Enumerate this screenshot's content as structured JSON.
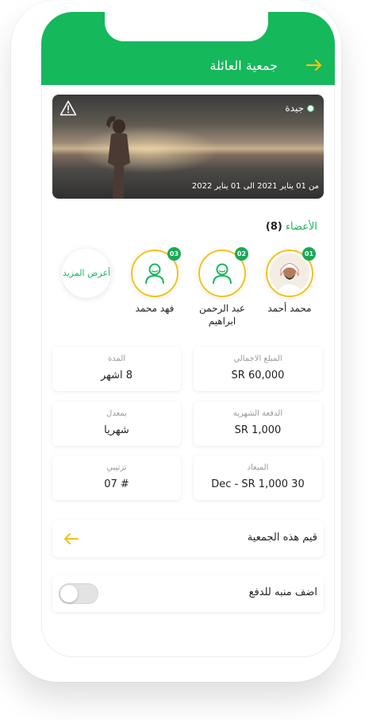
{
  "header": {
    "title": "جمعية العائلة",
    "back_icon": "arrow-right-icon",
    "accent": "#15b85b"
  },
  "banner": {
    "status_label": "جيدة",
    "status_color": "#2bd16e",
    "date_range": "من 01 يناير 2021 الى 01 يناير 2022",
    "warning_icon": "warning-icon"
  },
  "members": {
    "title": "الأعضاء",
    "count": "(8)",
    "items": [
      {
        "number": "01",
        "name": "محمد أحمد",
        "avatar": "photo"
      },
      {
        "number": "02",
        "name": "عبد الرحمن ابراهيم",
        "avatar": "person-icon"
      },
      {
        "number": "03",
        "name": "فهد محمد",
        "avatar": "person-icon"
      }
    ],
    "more_label": "أعرض المزيد"
  },
  "stats": [
    {
      "label": "المبلغ الاجمالي",
      "value": "SR 60,000"
    },
    {
      "label": "المدة",
      "value": "8 اشهر"
    },
    {
      "label": "الدفعة الشهرية",
      "value": "SR 1,000"
    },
    {
      "label": "بمعدل",
      "value": "شهريا"
    },
    {
      "label": "الميعاد",
      "value": "30 Dec - SR 1,000"
    },
    {
      "label": "ترتيبي",
      "value": "# 07"
    }
  ],
  "rate_row": {
    "label": "قيم هذه الجمعية",
    "icon": "arrow-left-icon"
  },
  "reminder_row": {
    "label": "اضف منبه للدفع",
    "toggle_on": false
  },
  "colors": {
    "accent_yellow": "#f2c21b",
    "green": "#15b85b"
  }
}
